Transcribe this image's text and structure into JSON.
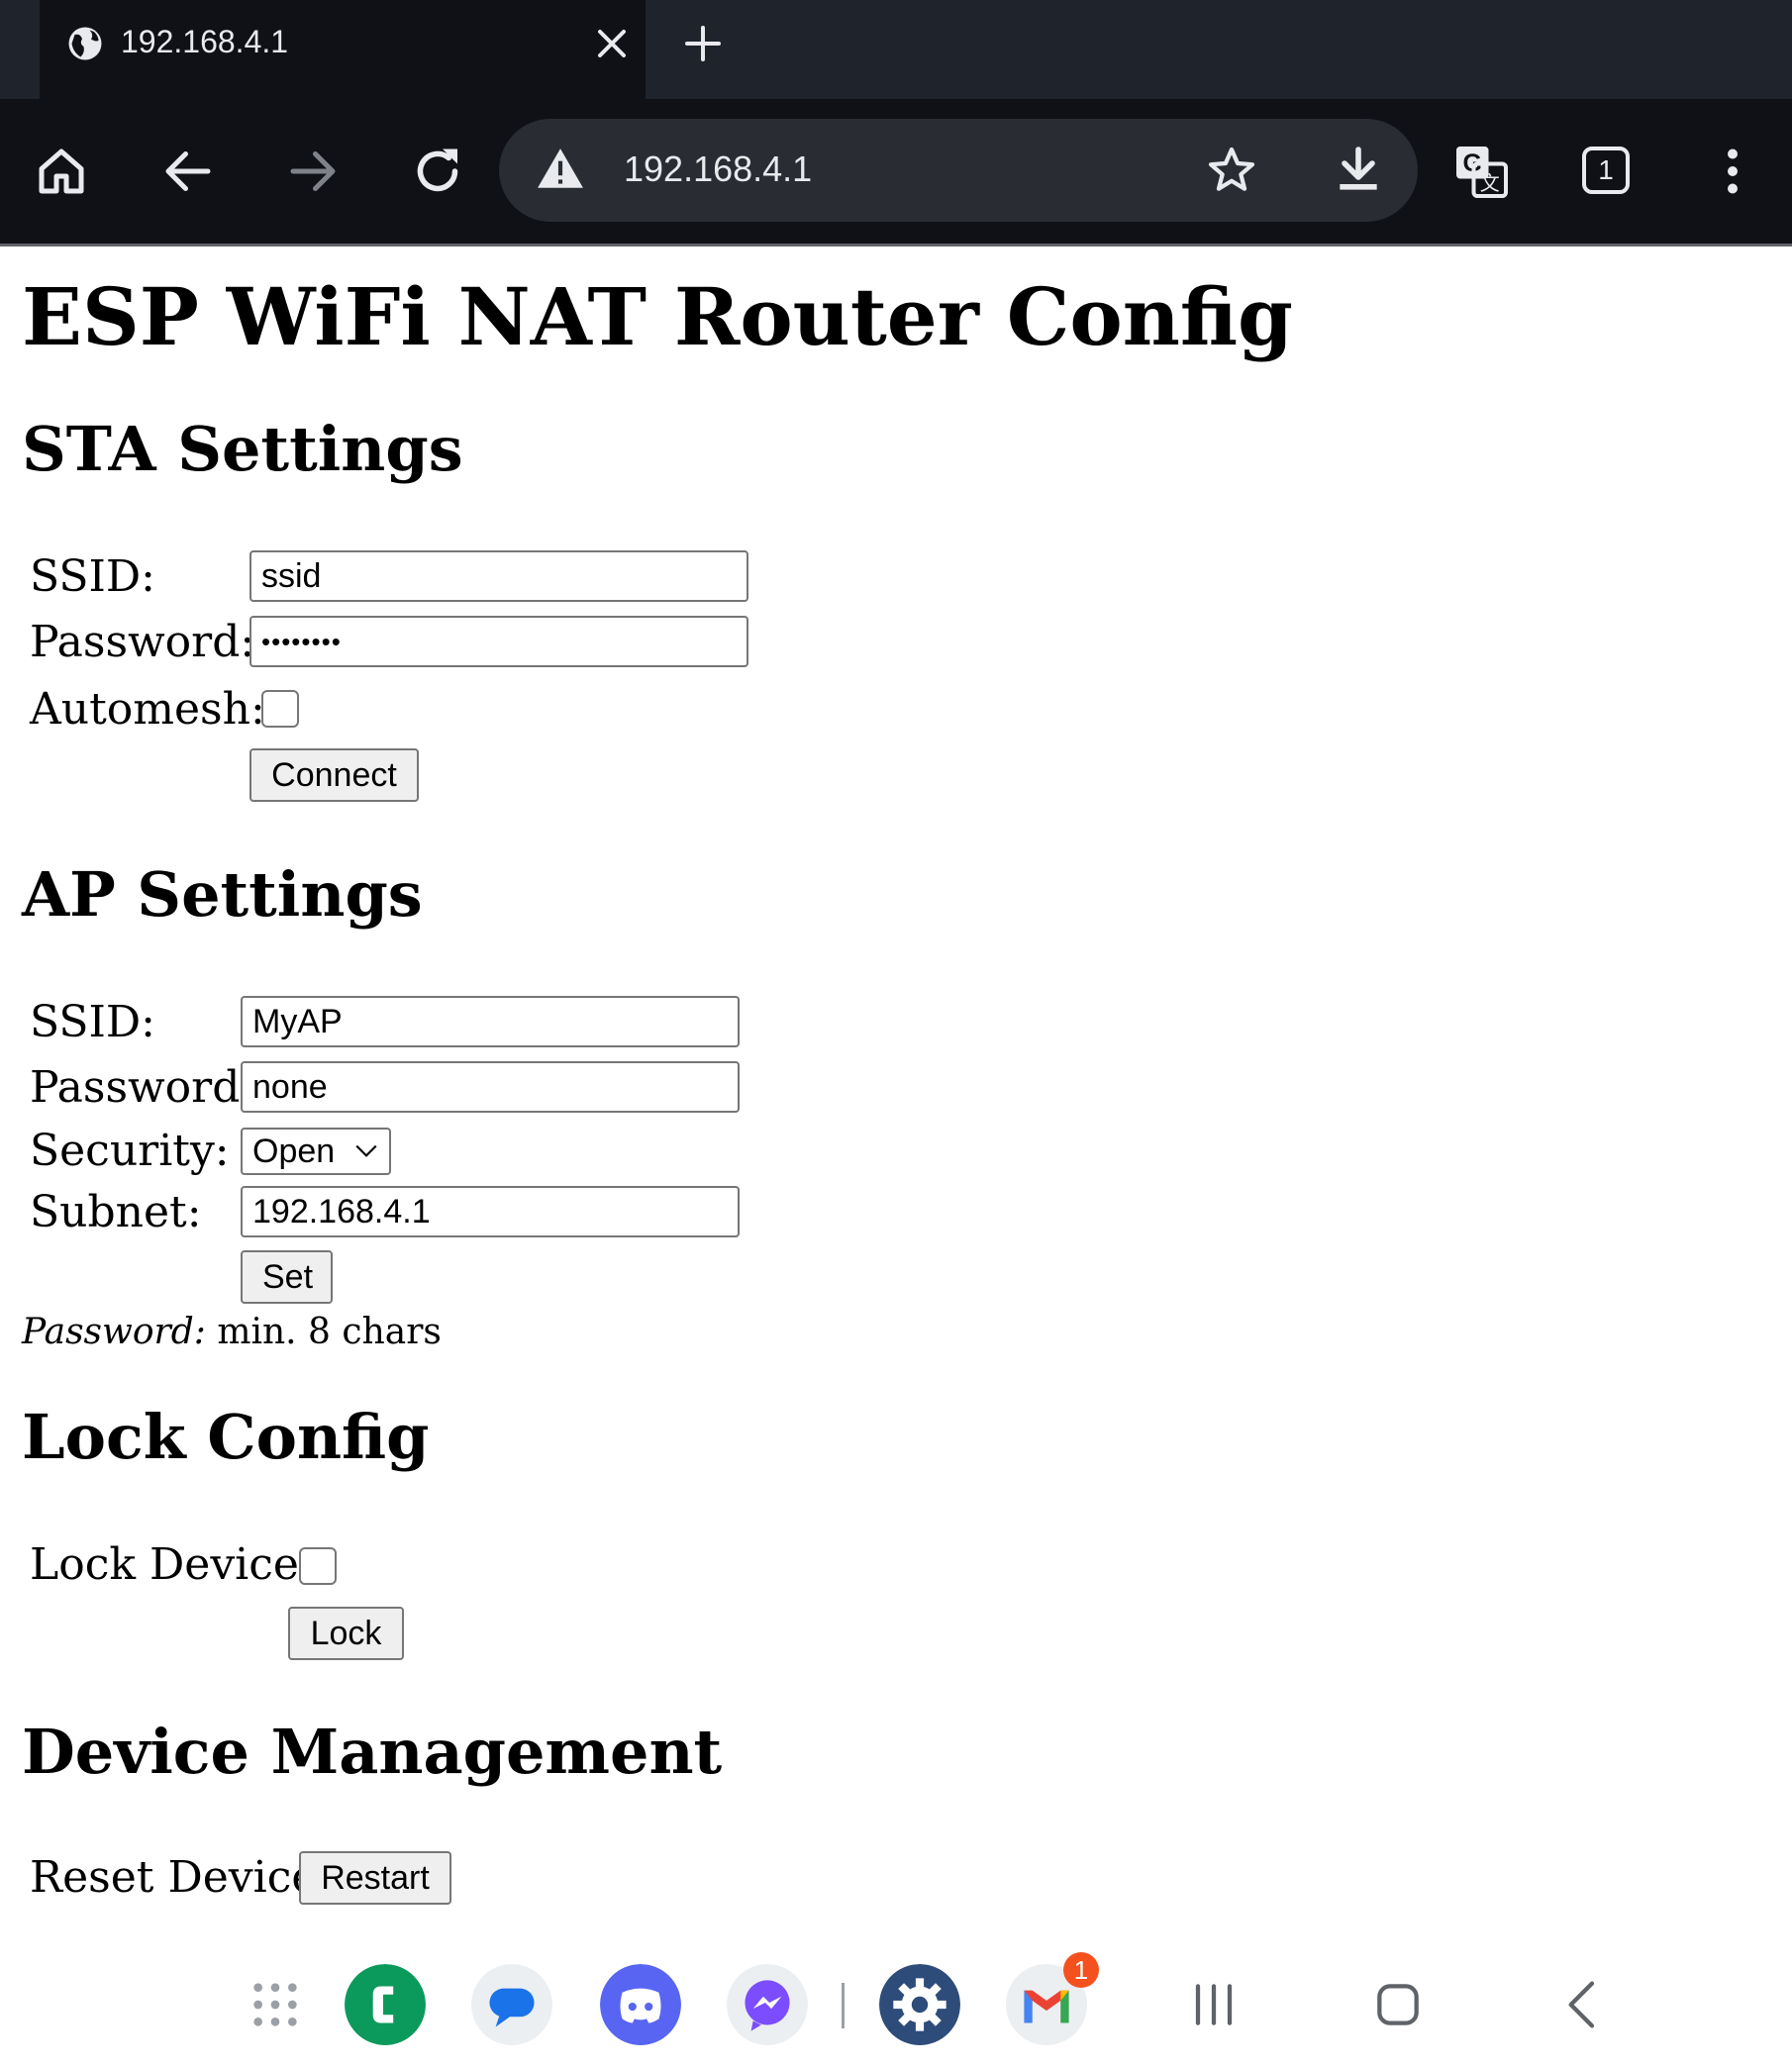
{
  "browser": {
    "tab_title": "192.168.4.1",
    "url": "192.168.4.1",
    "tab_count": "1"
  },
  "page": {
    "title": "ESP WiFi NAT Router Config",
    "sta": {
      "heading": "STA Settings",
      "ssid_label": "SSID:",
      "ssid_value": "ssid",
      "password_label": "Password:",
      "password_value": "••••••••",
      "automesh_label": "Automesh:",
      "connect_label": "Connect"
    },
    "ap": {
      "heading": "AP Settings",
      "ssid_label": "SSID:",
      "ssid_value": "MyAP",
      "password_label": "Password:",
      "password_value": "none",
      "security_label": "Security:",
      "security_value": "Open",
      "subnet_label": "Subnet:",
      "subnet_value": "192.168.4.1",
      "set_label": "Set",
      "note_em": "Password:",
      "note_text": " min. 8 chars"
    },
    "lock": {
      "heading": "Lock Config",
      "lock_device_label": "Lock Device:",
      "lock_label": "Lock"
    },
    "device": {
      "heading": "Device Management",
      "reset_label": "Reset Device:",
      "restart_label": "Restart"
    }
  },
  "navbar": {
    "gmail_badge": "1"
  },
  "colors": {
    "chrome_dark": "#0f1116",
    "tabstrip": "#1f232b",
    "omnibox": "#292c33",
    "chrome_text": "#e8eaed",
    "button_bg": "#efefef",
    "field_border": "#767676"
  }
}
